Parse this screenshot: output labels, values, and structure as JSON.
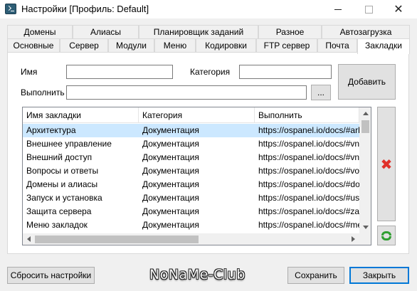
{
  "window": {
    "title": "Настройки [Профиль: Default]",
    "close_glyph": "✕"
  },
  "tabs_row1": [
    "Домены",
    "Алиасы",
    "Планировщик заданий",
    "Разное",
    "Автозагрузка"
  ],
  "tabs_row2": [
    "Основные",
    "Сервер",
    "Модули",
    "Меню",
    "Кодировки",
    "FTP сервер",
    "Почта",
    "Закладки"
  ],
  "active_tab": "Закладки",
  "form": {
    "name_label": "Имя",
    "name_value": "",
    "category_label": "Категория",
    "category_value": "",
    "execute_label": "Выполнить",
    "execute_value": "",
    "browse_label": "...",
    "add_label": "Добавить"
  },
  "list": {
    "columns": [
      "Имя закладки",
      "Категория",
      "Выполнить"
    ],
    "rows": [
      [
        "Архитектура",
        "Документация",
        "https://ospanel.io/docs/#arhi"
      ],
      [
        "Внешнее управление",
        "Документация",
        "https://ospanel.io/docs/#vne"
      ],
      [
        "Внешний доступ",
        "Документация",
        "https://ospanel.io/docs/#vne"
      ],
      [
        "Вопросы и ответы",
        "Документация",
        "https://ospanel.io/docs/#vop"
      ],
      [
        "Домены и алиасы",
        "Документация",
        "https://ospanel.io/docs/#dom"
      ],
      [
        "Запуск и установка",
        "Документация",
        "https://ospanel.io/docs/#usta"
      ],
      [
        "Защита сервера",
        "Документация",
        "https://ospanel.io/docs/#zasl"
      ],
      [
        "Меню закладок",
        "Документация",
        "https://ospanel.io/docs/#mer"
      ]
    ],
    "selected_index": 0
  },
  "footer": {
    "reset_label": "Сбросить настройки",
    "save_label": "Сохранить",
    "close_label": "Закрыть"
  },
  "watermark": "NoNaMe-Club",
  "icons": {
    "app": "terminal-icon",
    "delete": "red-x-delete-icon",
    "refresh": "green-refresh-icon"
  },
  "colors": {
    "selected_row": "#cce8ff",
    "delete_icon": "#e0312a",
    "refresh_icon": "#2f9e31",
    "primary_border": "#0078d7"
  }
}
